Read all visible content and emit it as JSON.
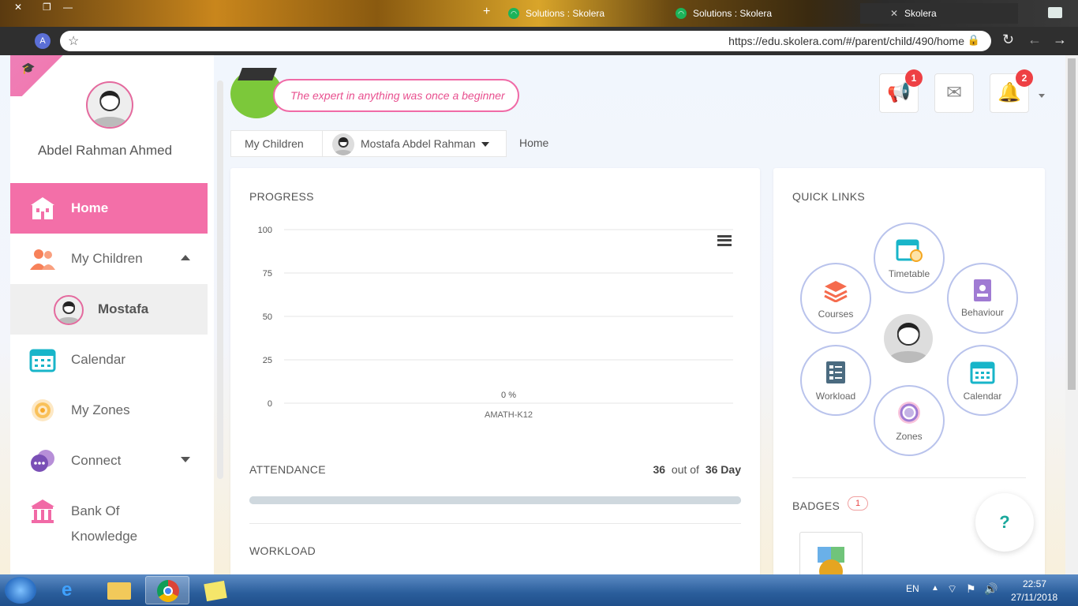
{
  "browser": {
    "window_controls": [
      "✕",
      "❐",
      "—"
    ],
    "tabs": [
      {
        "title": "Solutions : Skolera"
      },
      {
        "title": "Solutions : Skolera"
      },
      {
        "title": "Skolera",
        "close": "✕"
      }
    ],
    "new_tab": "+",
    "profile_initial": "A",
    "url": "https://edu.skolera.com/#/parent/child/490/home"
  },
  "sidebar": {
    "user_name": "Abdel Rahman Ahmed",
    "items": [
      {
        "label": "Home",
        "icon": "school-icon"
      },
      {
        "label": "My Children",
        "icon": "parents-icon"
      },
      {
        "label": "Mostafa",
        "icon": "avatar"
      },
      {
        "label": "Calendar",
        "icon": "calendar-icon"
      },
      {
        "label": "My Zones",
        "icon": "target-icon"
      },
      {
        "label": "Connect",
        "icon": "chat-icon"
      },
      {
        "label": "Bank Of Knowledge",
        "icon": "bank-icon"
      }
    ]
  },
  "header": {
    "quote": "The expert in anything was once a beginner",
    "announcements_badge": "1",
    "notifications_badge": "2"
  },
  "breadcrumb": {
    "my_children": "My Children",
    "child": "Mostafa Abdel Rahman",
    "home": "Home"
  },
  "progress": {
    "title": "PROGRESS"
  },
  "chart_data": {
    "type": "bar",
    "categories": [
      "AMATH-K12"
    ],
    "values": [
      0
    ],
    "data_labels": [
      "0 %"
    ],
    "yticks": [
      "100",
      "75",
      "50",
      "25",
      "0"
    ],
    "ylim": [
      0,
      100
    ],
    "grid": true
  },
  "attendance": {
    "title": "ATTENDANCE",
    "present": "36",
    "out_of": "out of",
    "total": "36 Day",
    "fraction": 1.0
  },
  "workload": {
    "title": "WORKLOAD"
  },
  "quick_links": {
    "title": "QUICK LINKS",
    "items": {
      "timetable": "Timetable",
      "courses": "Courses",
      "behaviour": "Behaviour",
      "workload": "Workload",
      "calendar": "Calendar",
      "zones": "Zones"
    }
  },
  "badges": {
    "title": "BADGES",
    "count": "1"
  },
  "help": {
    "label": "?"
  },
  "colors": {
    "accent_pink": "#f36fa8",
    "teal": "#1aa89c",
    "badge_red": "#ee4044"
  },
  "taskbar": {
    "language": "EN",
    "time": "22:57",
    "date": "27/11/2018"
  }
}
